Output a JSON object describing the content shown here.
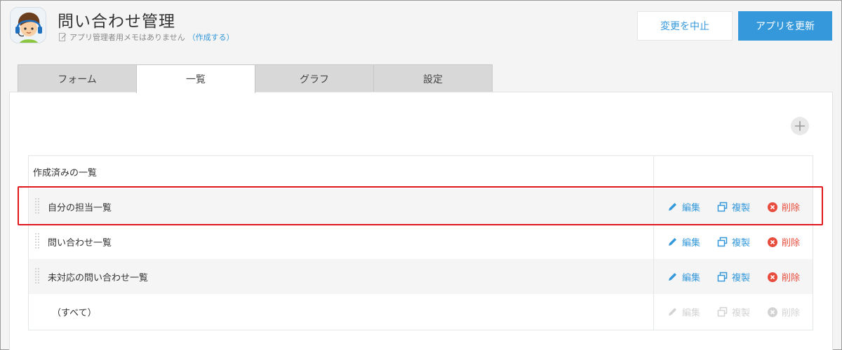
{
  "header": {
    "title": "問い合わせ管理",
    "memo": "アプリ管理者用メモはありません",
    "memo_link": "（作成する）",
    "cancel_label": "変更を中止",
    "update_label": "アプリを更新"
  },
  "tabs": [
    {
      "label": "フォーム",
      "active": false
    },
    {
      "label": "一覧",
      "active": true
    },
    {
      "label": "グラフ",
      "active": false
    },
    {
      "label": "設定",
      "active": false
    }
  ],
  "list": {
    "header": "作成済みの一覧",
    "rows": [
      {
        "name": "自分の担当一覧",
        "shaded": true,
        "highlighted": true,
        "disabled": false
      },
      {
        "name": "問い合わせ一覧",
        "shaded": false,
        "highlighted": false,
        "disabled": false
      },
      {
        "name": "未対応の問い合わせ一覧",
        "shaded": true,
        "highlighted": false,
        "disabled": false
      },
      {
        "name": "（すべて）",
        "shaded": false,
        "highlighted": false,
        "disabled": true
      }
    ],
    "actions": {
      "edit": "編集",
      "copy": "複製",
      "delete": "削除"
    }
  },
  "colors": {
    "accent": "#3498db",
    "danger": "#e74c3c",
    "highlight": "#e0161d",
    "disabled": "#d3d3d3"
  }
}
